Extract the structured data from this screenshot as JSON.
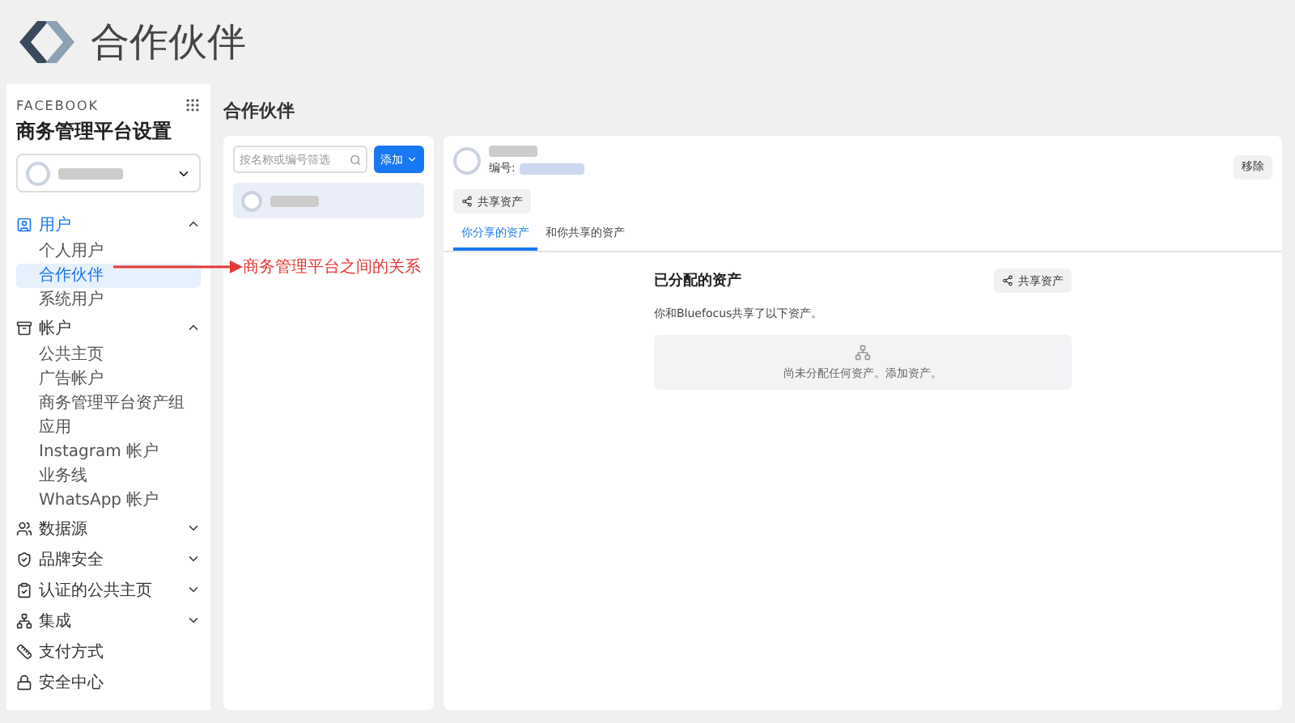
{
  "header": {
    "title": "合作伙伴"
  },
  "sidebar": {
    "brand": "FACEBOOK",
    "title": "商务管理平台设置",
    "sections": [
      {
        "label": "用户",
        "kind": "group",
        "expanded": true,
        "active": true,
        "children": [
          {
            "label": "个人用户",
            "selected": false
          },
          {
            "label": "合作伙伴",
            "selected": true
          },
          {
            "label": "系统用户",
            "selected": false
          }
        ]
      },
      {
        "label": "帐户",
        "kind": "group",
        "expanded": true,
        "active": false,
        "children": [
          {
            "label": "公共主页",
            "selected": false
          },
          {
            "label": "广告帐户",
            "selected": false
          },
          {
            "label": "商务管理平台资产组",
            "selected": false
          },
          {
            "label": "应用",
            "selected": false
          },
          {
            "label": "Instagram 帐户",
            "selected": false
          },
          {
            "label": "业务线",
            "selected": false
          },
          {
            "label": "WhatsApp 帐户",
            "selected": false
          }
        ]
      },
      {
        "label": "数据源",
        "kind": "group",
        "expanded": false,
        "active": false
      },
      {
        "label": "品牌安全",
        "kind": "group",
        "expanded": false,
        "active": false
      },
      {
        "label": "认证的公共主页",
        "kind": "group",
        "expanded": false,
        "active": false
      },
      {
        "label": "集成",
        "kind": "group",
        "expanded": false,
        "active": false
      },
      {
        "label": "支付方式",
        "kind": "link",
        "active": false
      },
      {
        "label": "安全中心",
        "kind": "link",
        "active": false
      }
    ]
  },
  "annotation": {
    "text": "商务管理平台之间的关系"
  },
  "main": {
    "title": "合作伙伴",
    "list": {
      "search_placeholder": "按名称或编号筛选",
      "add_button": "添加"
    },
    "detail": {
      "id_label": "编号:",
      "share_button": "共享资产",
      "remove_button": "移除",
      "tabs": [
        {
          "label": "你分享的资产",
          "selected": true
        },
        {
          "label": "和你共享的资产",
          "selected": false
        }
      ],
      "assigned_title": "已分配的资产",
      "assigned_share_button": "共享资产",
      "description": "你和Bluefocus共享了以下资产。",
      "empty_text": "尚未分配任何资产。添加资产。"
    }
  }
}
